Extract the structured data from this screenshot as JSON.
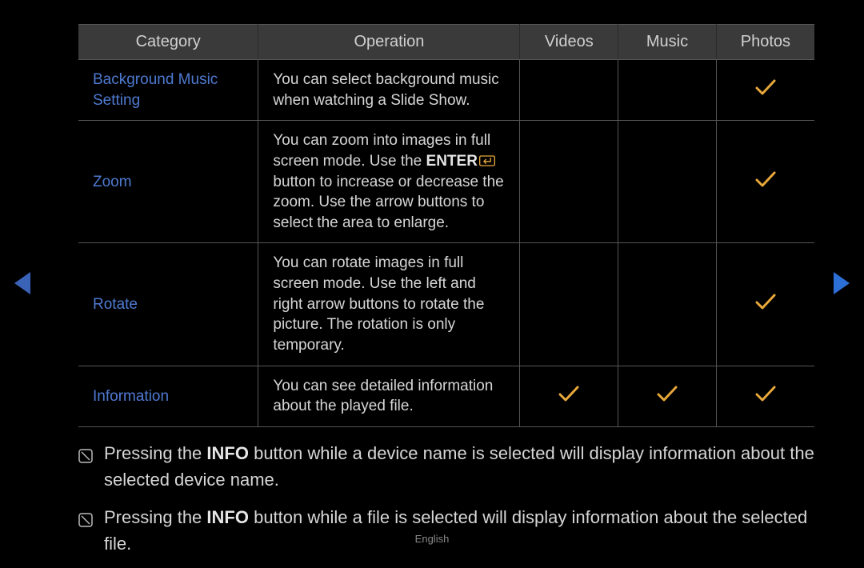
{
  "headers": {
    "category": "Category",
    "operation": "Operation",
    "videos": "Videos",
    "music": "Music",
    "photos": "Photos"
  },
  "rows": [
    {
      "category": "Background Music Setting",
      "operation_pre": "You can select background music when watching a Slide Show.",
      "has_enter": false,
      "operation_post": "",
      "videos": false,
      "music": false,
      "photos": true
    },
    {
      "category": "Zoom",
      "operation_pre": "You can zoom into images in full screen mode. Use the ",
      "bold_word": "ENTER",
      "has_enter": true,
      "operation_post": " button to increase or decrease the zoom. Use the arrow buttons to select the area to enlarge.",
      "videos": false,
      "music": false,
      "photos": true
    },
    {
      "category": "Rotate",
      "operation_pre": "You can rotate images in full screen mode. Use the left and right arrow buttons to rotate the picture. The rotation is only temporary.",
      "has_enter": false,
      "operation_post": "",
      "videos": false,
      "music": false,
      "photos": true
    },
    {
      "category": "Information",
      "operation_pre": "You can see detailed information about the played file.",
      "has_enter": false,
      "operation_post": "",
      "videos": true,
      "music": true,
      "photos": true
    }
  ],
  "notes": [
    {
      "pre": "Pressing the ",
      "bold": "INFO",
      "post": " button while a device name is selected will display information about the selected device name."
    },
    {
      "pre": "Pressing the ",
      "bold": "INFO",
      "post": " button while a file is selected will display information about the selected file."
    }
  ],
  "footer": "English"
}
